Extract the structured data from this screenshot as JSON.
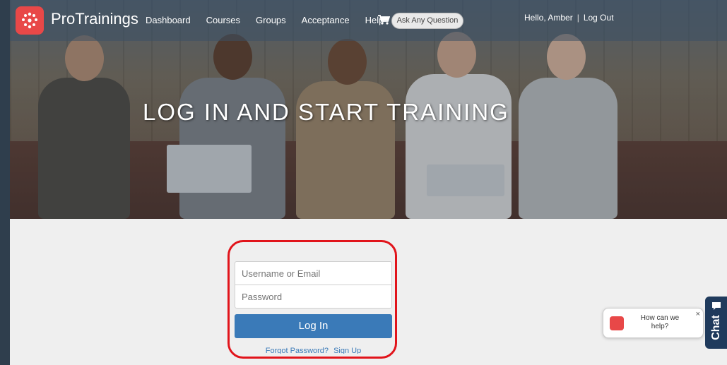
{
  "nav": {
    "brand": "ProTrainings",
    "links": [
      "Dashboard",
      "Courses",
      "Groups",
      "Acceptance",
      "Help"
    ],
    "ask_button": "Ask Any Question",
    "greeting": "Hello, Amber",
    "separator": "|",
    "logout": "Log Out"
  },
  "hero": {
    "title": "LOG IN AND START TRAINING"
  },
  "login": {
    "username_placeholder": "Username or Email",
    "password_placeholder": "Password",
    "button": "Log In",
    "forgot": "Forgot Password?",
    "signup": "Sign Up"
  },
  "chat": {
    "bubble_text": "How can we help?",
    "close": "×",
    "tab_label": "Chat"
  },
  "colors": {
    "brand_red": "#e84848",
    "primary_blue": "#3a7ab8",
    "highlight_red": "#e1141b",
    "chat_tab": "#1f3a5c"
  }
}
